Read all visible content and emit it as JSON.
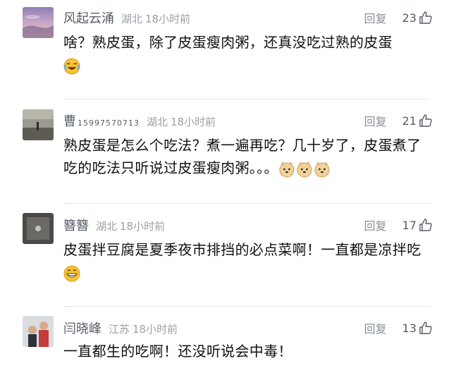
{
  "comments": [
    {
      "name": "风起云涌",
      "name_suffix": "",
      "location": "湖北",
      "time": "18小时前",
      "reply_label": "回复",
      "likes": "23",
      "text": "啥？熟皮蛋，除了皮蛋瘦肉粥，还真没吃过熟的皮蛋",
      "emoji": "laughing-crying-emoji"
    },
    {
      "name": "曹",
      "name_suffix": "15997570713",
      "location": "湖北",
      "time": "18小时前",
      "reply_label": "回复",
      "likes": "21",
      "text": "熟皮蛋是怎么个吃法？煮一遍再吃？几十岁了，皮蛋煮了吃的吃法只听说过皮蛋瘦肉粥。。。",
      "emoji": "doge-emoji"
    },
    {
      "name": "簪簪",
      "name_suffix": "",
      "location": "湖北",
      "time": "18小时前",
      "reply_label": "回复",
      "likes": "17",
      "text": "皮蛋拌豆腐是夏季夜市排挡的必点菜啊！一直都是凉拌吃",
      "emoji": "grinning-emoji"
    },
    {
      "name": "闫晓峰",
      "name_suffix": "",
      "location": "江苏",
      "time": "18小时前",
      "reply_label": "回复",
      "likes": "13",
      "text": "一直都生的吃啊！还没听说会中毒！",
      "emoji": ""
    }
  ],
  "colors": {
    "name": "#555b66",
    "meta": "#9aa0a8",
    "body_text": "#111111",
    "divider": "#e6e6e6"
  }
}
